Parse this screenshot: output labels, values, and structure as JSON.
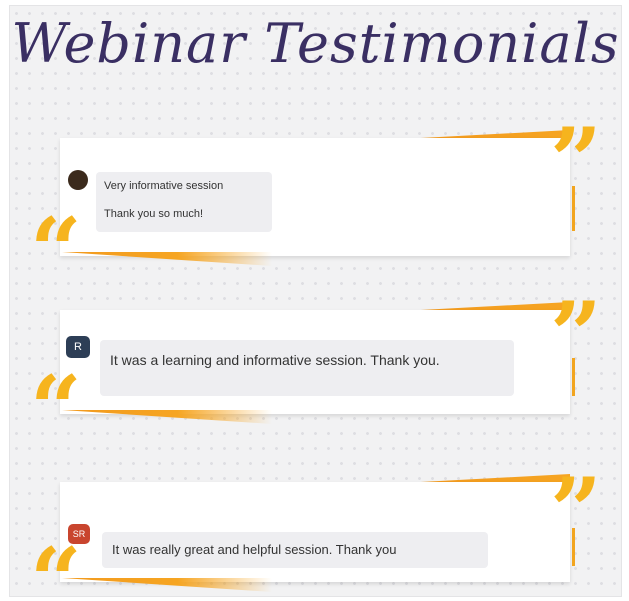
{
  "title": "Webinar Testimonials",
  "testimonials": [
    {
      "avatar_initial": "",
      "lines": [
        "Very informative session",
        "Thank you so much!"
      ]
    },
    {
      "avatar_initial": "R",
      "text": "It was a learning and informative session. Thank you."
    },
    {
      "avatar_initial": "SR",
      "text": "It was really great and helpful session. Thank you"
    }
  ],
  "quote_open": "“",
  "quote_close": "”",
  "colors": {
    "accent": "#f6b41e",
    "stripe": "#f29a1e",
    "title": "#3a2f63",
    "background": "#f2f2f3"
  }
}
